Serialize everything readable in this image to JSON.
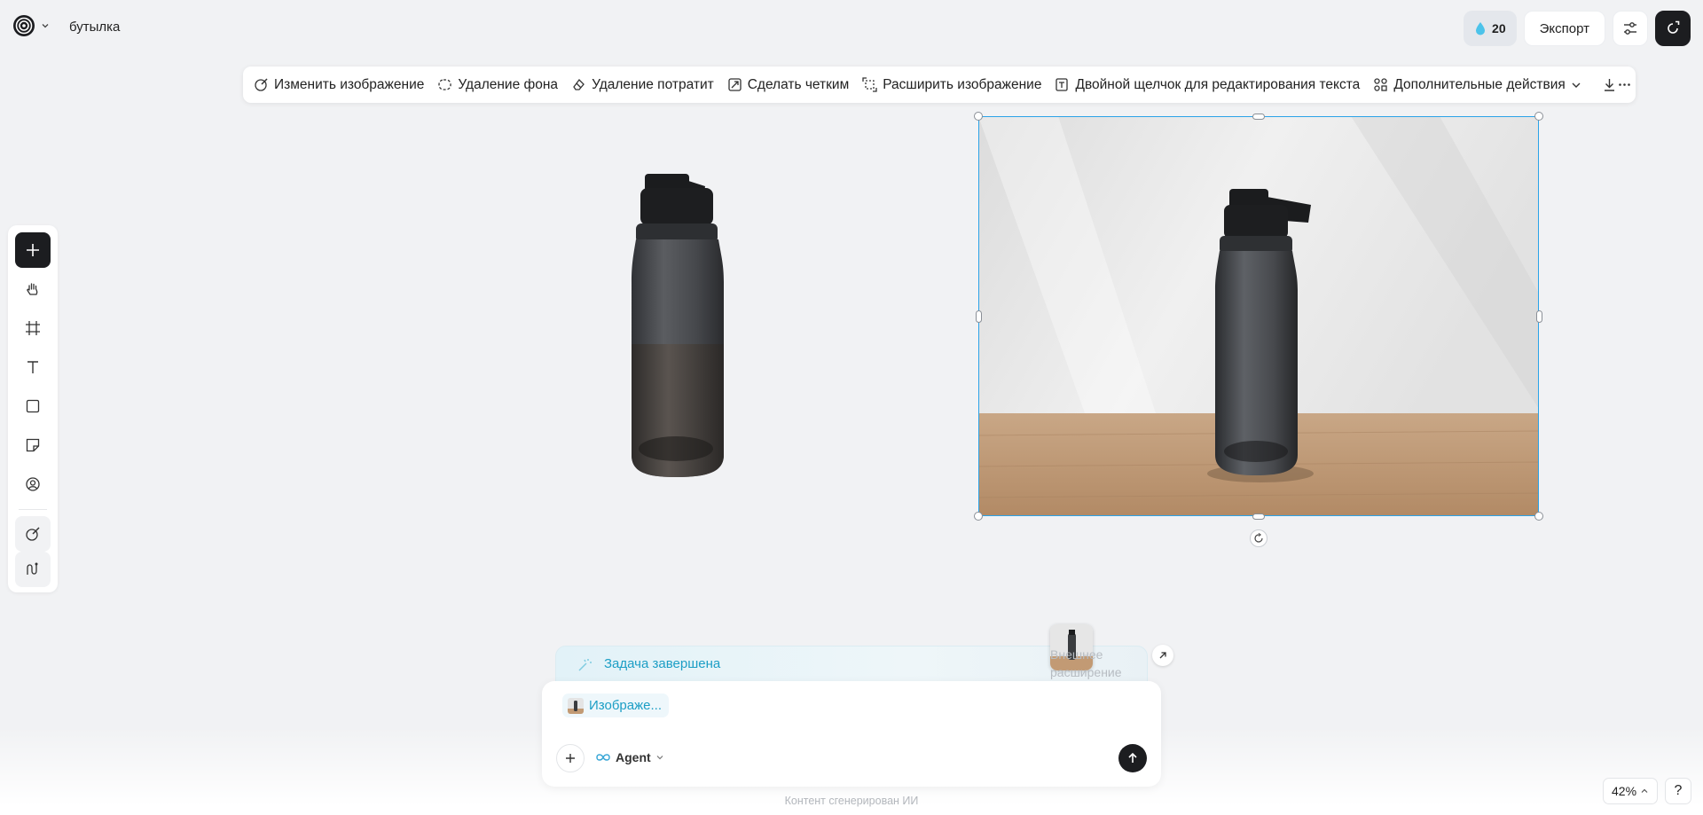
{
  "header": {
    "doc_title": "бутылка",
    "credits": "20",
    "export_label": "Экспорт"
  },
  "toolbar": {
    "items": [
      {
        "label": "Изменить изображение",
        "icon": "edit-image-icon"
      },
      {
        "label": "Удаление фона",
        "icon": "remove-background-icon"
      },
      {
        "label": "Удаление потратит",
        "icon": "eraser-icon"
      },
      {
        "label": "Сделать четким",
        "icon": "sharpen-icon"
      },
      {
        "label": "Расширить изображение",
        "icon": "expand-image-icon"
      },
      {
        "label": "Двойной щелчок для редактирования текста",
        "icon": "text-edit-icon"
      },
      {
        "label": "Дополнительные действия",
        "icon": "more-actions-icon"
      }
    ]
  },
  "left_tools": [
    "plus-icon",
    "hand-icon",
    "frame-icon",
    "text-icon",
    "rectangle-icon",
    "sticky-note-icon",
    "avatar-icon",
    "magic-edit-icon",
    "workflow-icon"
  ],
  "task": {
    "status": "Задача завершена",
    "thumb_label": "Внешнее расширение"
  },
  "chat": {
    "chip_label": "Изображе...",
    "agent_label": "Agent",
    "footer_note": "Контент сгенерирован ИИ"
  },
  "zoom": {
    "level": "42%",
    "help": "?"
  },
  "colors": {
    "accent": "#2ba3e8",
    "task_text": "#1c9ec5",
    "dark_button": "#1c1d20",
    "canvas_bg": "#f1f2f4"
  }
}
